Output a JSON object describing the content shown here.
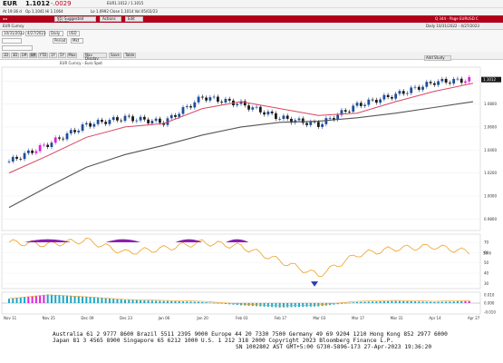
{
  "header": {
    "ticker": "EUR",
    "price": "1.1012",
    "change": "-.0029",
    "line2_left": "At 19:36 d",
    "line2_mid": "Op 1.1041 Hi 1.1064",
    "ohlc_detail": "EUR1.1012 / 1.1015",
    "ohlc_detail2": "Lo 1.0992 Close 1.1014 Val 05/02/23"
  },
  "toolbar": {
    "buttons": [
      "95) Suggested Charts",
      "Actions",
      "Edit"
    ],
    "right_text": "Q 344 - Page EURUSD C"
  },
  "security_bar": {
    "label": "EUR Curncy",
    "right_text": "Daily 10/31/2022 - 4/27/2023"
  },
  "controls": {
    "range_start": "10/31/2022",
    "range_end": "4/27/2023",
    "frequency": "Daily",
    "currency": "USD",
    "period_label": "Period",
    "mode_label": "Mkt",
    "ranges": [
      "1D",
      "3D",
      "1M",
      "6M",
      "YTD",
      "1Y",
      "5Y",
      "Max"
    ],
    "options": [
      "Nav Display",
      "Save",
      "Table"
    ],
    "legend_text": "EUR Curncy - Euro Spot",
    "add_study": "Add Study"
  },
  "chart_data": [
    {
      "type": "line",
      "panel": "price",
      "x": [
        "Nov 11",
        "Nov 25",
        "Dec 09",
        "Dec 23",
        "Jan 06",
        "Jan 20",
        "Feb 03",
        "Feb 17",
        "Mar 03",
        "Mar 17",
        "Mar 31",
        "Apr 14",
        "Apr 27"
      ],
      "series": [
        {
          "values": [
            1.03,
            1.045,
            1.062,
            1.068,
            1.064,
            1.086,
            1.08,
            1.068,
            1.062,
            1.079,
            1.088,
            1.099,
            1.1012
          ]
        },
        {
          "values": [
            1.02,
            1.035,
            1.051,
            1.06,
            1.063,
            1.076,
            1.082,
            1.076,
            1.07,
            1.072,
            1.082,
            1.091,
            1.098
          ]
        },
        {
          "values": [
            0.99,
            1.008,
            1.025,
            1.036,
            1.044,
            1.053,
            1.06,
            1.064,
            1.065,
            1.068,
            1.072,
            1.077,
            1.082
          ]
        }
      ],
      "y_ticks": [
        "1.1000",
        "1.0800",
        "1.0600",
        "1.0400",
        "1.0200",
        "1.0000",
        "0.9800"
      ],
      "ylim": [
        0.97,
        1.112
      ],
      "last_value": "1.1012"
    },
    {
      "type": "line",
      "panel": "rsi",
      "series": [
        {
          "values": [
            70,
            68,
            72,
            60,
            64,
            70,
            66,
            52,
            38,
            58,
            64,
            66,
            60
          ]
        }
      ],
      "y_ticks": [
        "70",
        "60",
        "50",
        "40",
        "30"
      ],
      "ylim": [
        25,
        78
      ],
      "last_value": "59.6"
    },
    {
      "type": "bar",
      "panel": "macd",
      "values": [
        0.004,
        0.008,
        0.006,
        0.003,
        0.002,
        0.001,
        -0.002,
        -0.004,
        -0.003,
        0.001,
        0.002,
        0.001,
        0.002
      ],
      "y_ticks": [
        "0.010",
        "0.000",
        "-0.010"
      ]
    }
  ],
  "x_axis_labels": [
    "Nov 11",
    "Nov 25",
    "Dec 09",
    "Dec 23",
    "Jan 06",
    "Jan 20",
    "Feb 03",
    "Feb 17",
    "Mar 03",
    "Mar 17",
    "Mar 31",
    "Apr 14",
    "Apr 27"
  ],
  "footer": {
    "line1": "Australia 61 2 9777 8600 Brazil 5511 2395 9000 Europe 44 20 7330 7500 Germany 49 69 9204 1210 Hong Kong 852 2977 6000",
    "line2": "Japan 81 3 4565 8900        Singapore 65 6212 1000        U.S. 1 212 318 2000         Copyright 2023 Bloomberg Finance L.P.",
    "line3": "SN 1002802 AST  GMT+5:00 G730-5896-173 27-Apr-2023 19:36:20"
  },
  "colors": {
    "accent_red": "#c0001e",
    "up_candle": "#1f4e9c",
    "down_candle": "#1a1a1a",
    "highlight_candle": "#e020e0",
    "ma_fast": "#d9455f",
    "ma_slow": "#555555",
    "rsi_line": "#f0a020",
    "macd_bar": "#18a8c8"
  }
}
